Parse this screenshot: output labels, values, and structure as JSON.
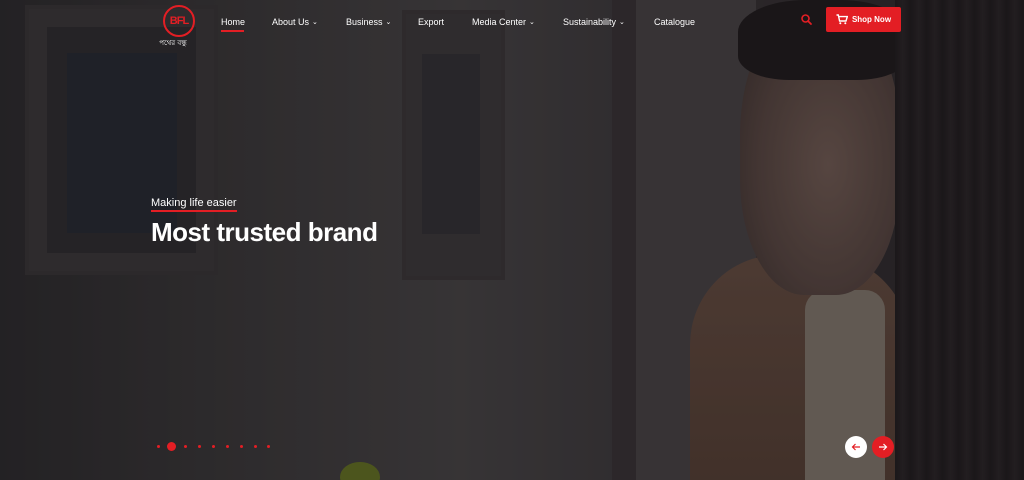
{
  "logo": {
    "text": "BFL",
    "subtitle": "পথের বন্ধু"
  },
  "nav": {
    "items": [
      {
        "label": "Home",
        "dropdown": false
      },
      {
        "label": "About Us",
        "dropdown": true
      },
      {
        "label": "Business",
        "dropdown": true
      },
      {
        "label": "Export",
        "dropdown": false
      },
      {
        "label": "Media Center",
        "dropdown": true
      },
      {
        "label": "Sustainability",
        "dropdown": true
      },
      {
        "label": "Catalogue",
        "dropdown": false
      }
    ],
    "active": "Home",
    "chevron": "⌄"
  },
  "header": {
    "search_icon": "search-icon",
    "shop_label": "Shop Now",
    "shop_icon": "cart-icon"
  },
  "hero": {
    "tagline": "Making life easier",
    "headline": "Most trusted brand",
    "slides_count": 9,
    "active_slide": 2
  },
  "colors": {
    "accent": "#e31e24",
    "text": "#ffffff"
  }
}
